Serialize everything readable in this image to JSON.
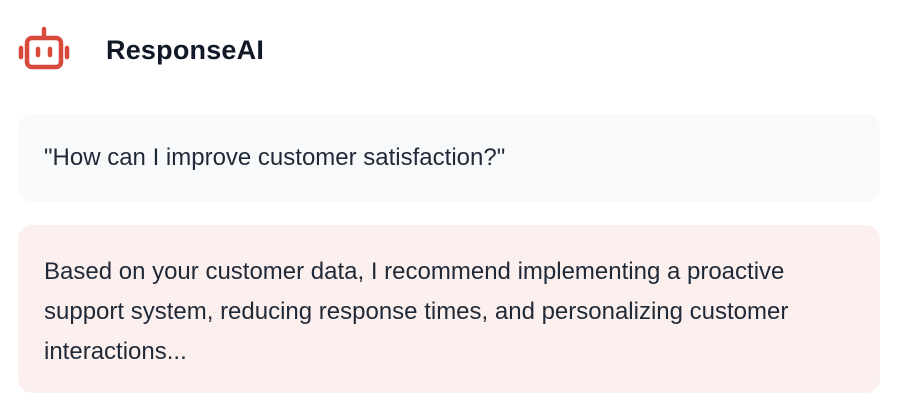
{
  "app": {
    "name": "ResponseAI",
    "logo_icon": "robot-icon",
    "brand_color": "#d94a3d"
  },
  "conversation": {
    "user_message": "\"How can I improve customer satisfaction?\"",
    "ai_response": "Based on your customer data, I recommend implementing a proactive support system, reducing response times, and personalizing customer interactions..."
  },
  "colors": {
    "user_bubble_bg": "#f8f9fb",
    "ai_bubble_bg": "#fcf0ef",
    "text": "#1f2937"
  }
}
